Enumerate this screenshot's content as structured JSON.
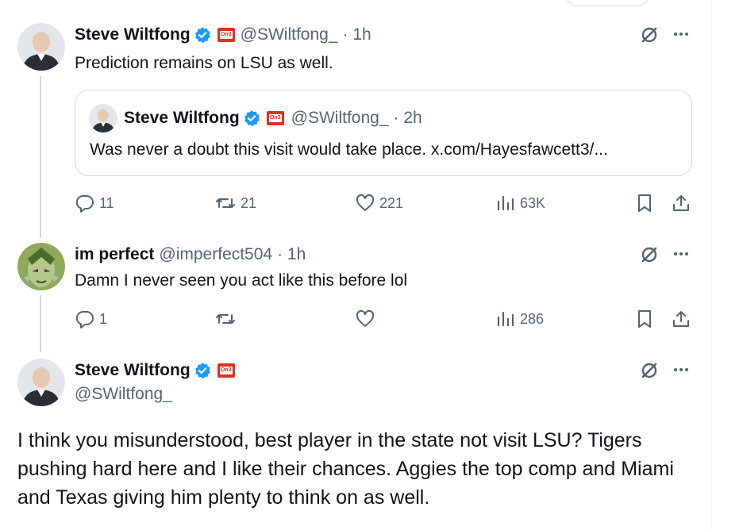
{
  "tweets": [
    {
      "name": "Steve Wiltfong",
      "handle": "@SWiltfong_",
      "time": "· 1h",
      "text": "Prediction remains on LSU as well.",
      "quote": {
        "name": "Steve Wiltfong",
        "handle": "@SWiltfong_",
        "time": "· 2h",
        "text": "Was never a doubt this visit would take place. x.com/Hayesfawcett3/..."
      },
      "replies": "11",
      "reposts": "21",
      "likes": "221",
      "views": "63K"
    },
    {
      "name": "im perfect",
      "handle": "@imperfect504",
      "time": "· 1h",
      "text": "Damn I never seen you act like this before lol",
      "replies": "1",
      "reposts": "",
      "likes": "",
      "views": "286"
    },
    {
      "name": "Steve Wiltfong",
      "handle": "@SWiltfong_",
      "text": "I think you misunderstood, best player in the state not visit LSU? Tigers pushing hard here and I like their chances. Aggies the top comp and Miami and Texas giving him plenty to think on as well."
    }
  ],
  "badges": {
    "affiliate_text": "On3"
  },
  "icons": {
    "verified": "verified-badge-icon",
    "grok": "grok-icon",
    "more": "more-icon",
    "reply": "reply-icon",
    "repost": "repost-icon",
    "like": "like-icon",
    "views": "views-icon",
    "bookmark": "bookmark-icon",
    "share": "share-icon"
  },
  "colors": {
    "verified_blue": "#1d9bf0",
    "affiliate_red": "#e0301e",
    "secondary_text": "#536471",
    "thread_line": "#cfd9de"
  }
}
